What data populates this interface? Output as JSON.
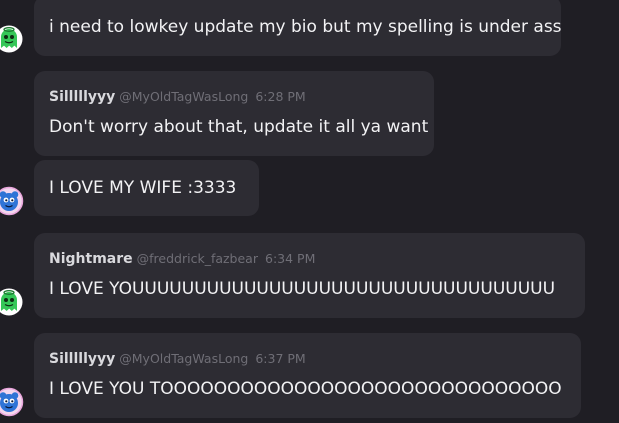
{
  "messages": [
    {
      "author": "",
      "tag": "",
      "time": "",
      "text": "i need to lowkey update my bio but my spelling is under ass",
      "avatar": "green-ghost-icon"
    },
    {
      "author": "Silllllyyy",
      "tag": "@MyOldTagWasLong",
      "time": "6:28 PM",
      "text": "Don't worry about that, update it all ya want",
      "avatar": ""
    },
    {
      "author": "",
      "tag": "",
      "time": "",
      "text": "I LOVE MY WIFE :3333",
      "avatar": "blue-creature-icon"
    },
    {
      "author": "Nightmare",
      "tag": "@freddrick_fazbear",
      "time": "6:34 PM",
      "text": "I LOVE YOUUUUUUUUUUUUUUUUUUUUUUUUUUUUUUUUUU",
      "avatar": "green-ghost-icon"
    },
    {
      "author": "Silllllyyy",
      "tag": "@MyOldTagWasLong",
      "time": "6:37 PM",
      "text": "I LOVE YOU TOOOOOOOOOOOOOOOOOOOOOOOOOOOOOO",
      "avatar": "blue-creature-icon"
    }
  ],
  "colors": {
    "background": "#1f1e24",
    "bubble": "#2d2c33",
    "text": "#f2f2f4",
    "meta": "#6f6e76"
  }
}
